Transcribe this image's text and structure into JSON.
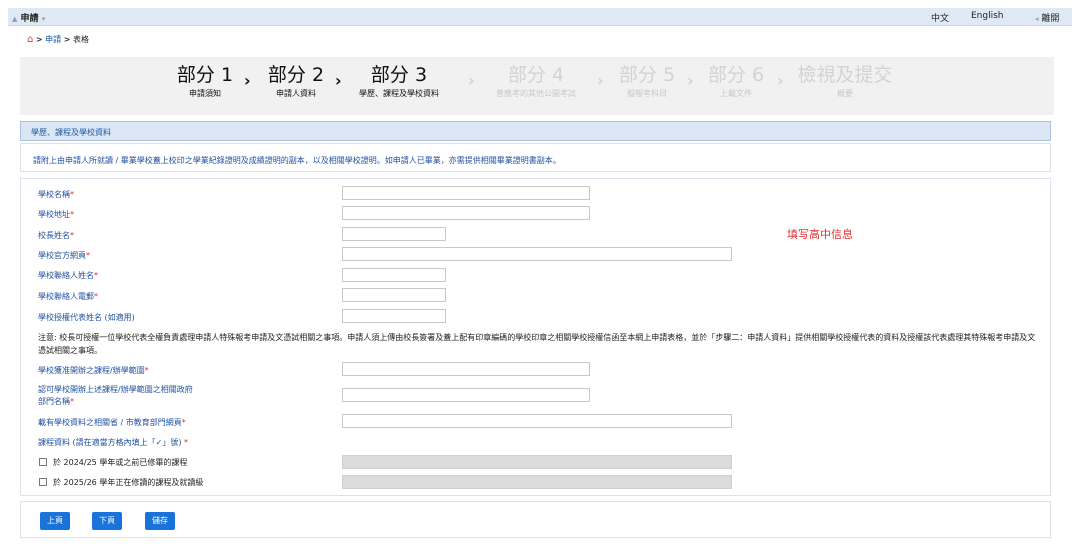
{
  "topbar": {
    "menu_label": "申請",
    "lang_zh": "中文",
    "lang_en": "English",
    "logout_label": "離開"
  },
  "breadcrumb": {
    "home_sep": ">",
    "item1": "申請",
    "sep2": ">",
    "item2": "表格"
  },
  "steps": [
    {
      "num": "部分 1",
      "sub": "申請須知",
      "active": true
    },
    {
      "num": "部分 2",
      "sub": "申請人資料",
      "active": true
    },
    {
      "num": "部分 3",
      "sub": "學歷、課程及學校資料",
      "active": true
    },
    {
      "num": "部分 4",
      "sub": "曾應考的其他公開考試",
      "active": false
    },
    {
      "num": "部分 5",
      "sub": "擬報考科目",
      "active": false
    },
    {
      "num": "部分 6",
      "sub": "上載文件",
      "active": false
    },
    {
      "num": "檢視及提交",
      "sub": "概要",
      "active": false
    }
  ],
  "section": {
    "title": "學歷、課程及學校資料",
    "notice": "請附上由申請人所就讀 / 畢業學校蓋上校印之學業紀錄證明及成績證明的副本，以及相關學校證明。如申請人已畢業，亦需提供相關畢業證明書副本。"
  },
  "fields": {
    "school_name": "學校名稱",
    "school_address": "學校地址",
    "principal_name": "校長姓名",
    "school_website": "學校官方網頁",
    "contact_name": "學校聯絡人姓名",
    "contact_email": "學校聯絡人電郵",
    "authorized_rep": "學校授權代表姓名 (如適用)",
    "approved_scope": "學校獲准開辦之課程/辦學範圍",
    "gov_dept_line1": "認可學校開辦上述課程/辦學範圍之相關政府",
    "gov_dept_line2": "部門名稱",
    "gov_website": "載有學校資料之相關省 / 市教育部門網頁",
    "course_info": "課程資料 (請在適當方格內填上「✓」號)",
    "required_mark": "*"
  },
  "annotation": "填写高中信息",
  "note_text": "注意: 校長可授權一位學校代表全權負責處理申請人特殊報考申請及文憑試相關之事項。申請人須上傳由校長簽署及蓋上配有印章編碼的學校印章之相關學校授權信函至本網上申請表格，並於「步驟二：申請人資料」提供相關學校授權代表的資料及授權該代表處理其特殊報考申請及文憑試相關之事項。",
  "checkboxes": [
    {
      "label": "於 2024/25 學年或之前已修畢的課程",
      "checked": false
    },
    {
      "label": "於 2025/26 學年正在修讀的課程及就讀級",
      "checked": false
    }
  ],
  "buttons": {
    "prev": "上頁",
    "next": "下頁",
    "save": "儲存"
  },
  "colors": {
    "accent": "#1a73d9",
    "required": "#e03030",
    "label": "#2150a0"
  }
}
